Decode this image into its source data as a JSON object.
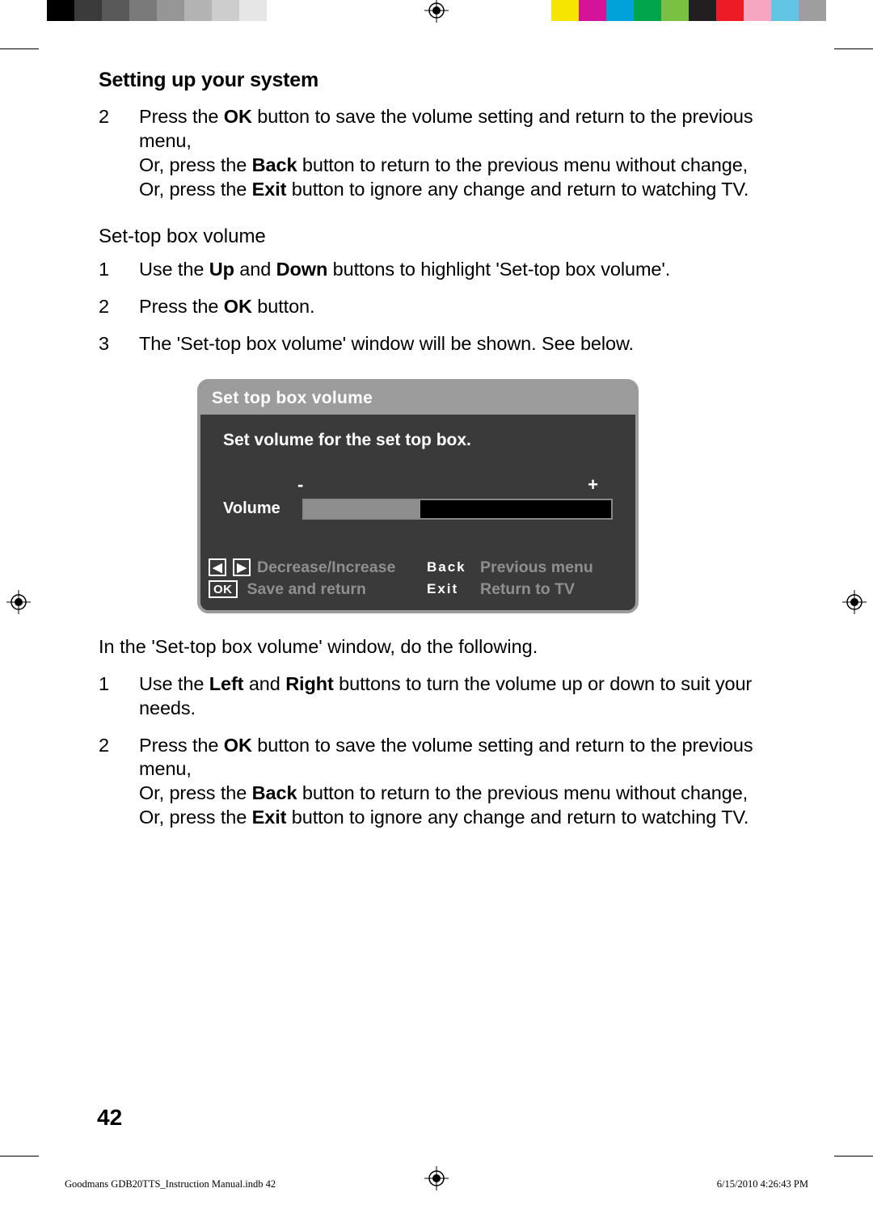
{
  "section_title": "Setting up your system",
  "top_steps": [
    {
      "num": "2",
      "lines": [
        {
          "plain_before": "Press the ",
          "bold": "OK",
          "plain_after": " button to save the volume setting and return to the previous menu,"
        },
        {
          "plain_before": "Or, press the ",
          "bold": "Back",
          "plain_after": " button to return to the previous menu without change,"
        },
        {
          "plain_before": "Or, press the ",
          "bold": "Exit",
          "plain_after": " button to ignore any change and return to watching TV."
        }
      ]
    }
  ],
  "sub_title": "Set-top box volume",
  "mid_steps": [
    {
      "num": "1",
      "lines": [
        {
          "plain_before": "Use the ",
          "bold": "Up",
          "plain_mid": " and ",
          "bold2": "Down",
          "plain_after": " buttons to highlight 'Set-top box volume'."
        }
      ]
    },
    {
      "num": "2",
      "lines": [
        {
          "plain_before": "Press the ",
          "bold": "OK",
          "plain_after": " button."
        }
      ]
    },
    {
      "num": "3",
      "lines": [
        {
          "plain_before": "The 'Set-top box volume' window will be shown. See below."
        }
      ]
    }
  ],
  "osd": {
    "title": "Set top box volume",
    "instruction": "Set volume for the set top box.",
    "minus": "-",
    "plus": "+",
    "volume_label": "Volume",
    "footer": {
      "arrows_label": "Decrease/Increase",
      "back_key": "Back",
      "back_label": "Previous menu",
      "ok_key": "OK",
      "ok_label": "Save and return",
      "exit_key": "Exit",
      "exit_label": "Return to TV"
    }
  },
  "post_osd_intro": "In the 'Set-top box volume' window, do the following.",
  "bottom_steps": [
    {
      "num": "1",
      "lines": [
        {
          "plain_before": "Use the ",
          "bold": "Left",
          "plain_mid": " and ",
          "bold2": "Right",
          "plain_after": " buttons to turn the volume up or down to suit your needs."
        }
      ]
    },
    {
      "num": "2",
      "lines": [
        {
          "plain_before": "Press the ",
          "bold": "OK",
          "plain_after": " button to save the volume setting and return to the previous menu,"
        },
        {
          "plain_before": "Or, press the ",
          "bold": "Back",
          "plain_after": " button to return to the previous menu without change,"
        },
        {
          "plain_before": "Or, press the ",
          "bold": "Exit",
          "plain_after": " button to ignore any change and return to watching TV."
        }
      ]
    }
  ],
  "page_number": "42",
  "footer_file": "Goodmans GDB20TTS_Instruction Manual.indb   42",
  "footer_date": "6/15/2010   4:26:43 PM",
  "colors_left": [
    "#000000",
    "#3b3b3b",
    "#595959",
    "#7a7a7a",
    "#969696",
    "#b3b3b3",
    "#cdcdcd",
    "#e6e6e6",
    "#ffffff"
  ],
  "colors_right": [
    "#f6e500",
    "#d41398",
    "#00a3d9",
    "#00a44a",
    "#7ac143",
    "#231f20",
    "#ed1c24",
    "#f6a6c1",
    "#63c5e5",
    "#9e9e9e"
  ]
}
